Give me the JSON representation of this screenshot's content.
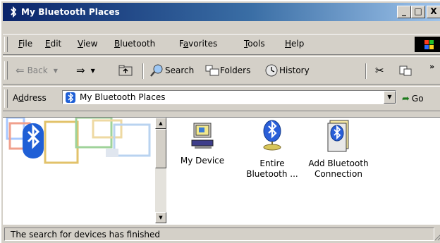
{
  "window": {
    "title": "My Bluetooth Places"
  },
  "titlebar_buttons": {
    "minimize": "_",
    "maximize": "□",
    "close": "X"
  },
  "menu": [
    {
      "label": "File",
      "mnemonic": "F",
      "rest": "ile"
    },
    {
      "label": "Edit",
      "mnemonic": "E",
      "rest": "dit"
    },
    {
      "label": "View",
      "mnemonic": "V",
      "rest": "iew"
    },
    {
      "label": "Bluetooth",
      "mnemonic": "B",
      "rest": "luetooth"
    },
    {
      "label": "Favorites",
      "mnemonic": "a",
      "pre": "F",
      "rest": "vorites"
    },
    {
      "label": "Tools",
      "mnemonic": "T",
      "rest": "ools"
    },
    {
      "label": "Help",
      "mnemonic": "H",
      "rest": "elp"
    }
  ],
  "toolbar": {
    "back": "Back",
    "search": "Search",
    "folders": "Folders",
    "history": "History",
    "more": "»"
  },
  "address": {
    "label": "Address",
    "value": "My Bluetooth Places",
    "go": "Go"
  },
  "items": [
    {
      "line1": "My Device",
      "line2": "",
      "icon": "computer-icon"
    },
    {
      "line1": "Entire",
      "line2": "Bluetooth ...",
      "icon": "bluetooth-globe-icon"
    },
    {
      "line1": "Add Bluetooth",
      "line2": "Connection",
      "icon": "bluetooth-wizard-icon"
    }
  ],
  "status": {
    "text": "The search for devices has finished"
  },
  "colors": {
    "title_gradient_start": "#0a246a",
    "title_gradient_end": "#a6caf0",
    "chrome": "#d4d0c8",
    "bluetooth_blue": "#1f5fd6"
  }
}
